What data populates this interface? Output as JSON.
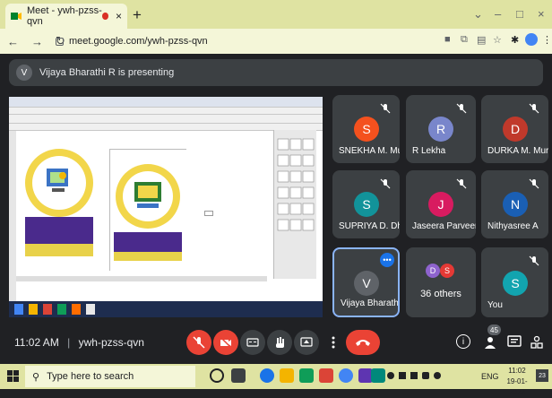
{
  "browser": {
    "tab_title": "Meet - ywh-pzss-qvn",
    "tab_close": "×",
    "new_tab": "+",
    "url": "meet.google.com/ywh-pzss-qvn",
    "window_controls": [
      "–",
      "□",
      "×"
    ]
  },
  "presenting": {
    "avatar": "V",
    "text": "Vijaya Bharathi R is presenting"
  },
  "participants": [
    {
      "initial": "S",
      "name": "SNEKHA M. Mu...",
      "color": "#f4511e"
    },
    {
      "initial": "R",
      "name": "R Lekha",
      "color": "#7986cb"
    },
    {
      "initial": "D",
      "name": "DURKA M. Mur...",
      "color": "#c0392b"
    },
    {
      "initial": "S",
      "name": "SUPRIYA D. Dh...",
      "color": "#12939a"
    },
    {
      "initial": "J",
      "name": "Jaseera Parveen",
      "color": "#d81b60"
    },
    {
      "initial": "N",
      "name": "Nithyasree A",
      "color": "#1a5fb4"
    },
    {
      "initial": "V",
      "name": "Vijaya Bharathi R",
      "color": "#5f6368"
    },
    {
      "initial": "",
      "name": "36 others",
      "color": "#3c4043"
    },
    {
      "initial": "S",
      "name": "You",
      "color": "#12a4af"
    }
  ],
  "others_avatars": [
    "D",
    "S"
  ],
  "meeting": {
    "time": "11:02 AM",
    "separator": "|",
    "code": "ywh-pzss-qvn",
    "people_count": "45"
  },
  "taskbar": {
    "search_placeholder": "Type here to search",
    "lang": "ENG",
    "clock_time": "11:02",
    "clock_date": "19-01-2022",
    "notify_count": "23"
  },
  "colors": {
    "meet_bg": "#202124",
    "tile_bg": "#3c4043",
    "end_call": "#ea4335",
    "chrome_bg": "#dfe3a2"
  }
}
